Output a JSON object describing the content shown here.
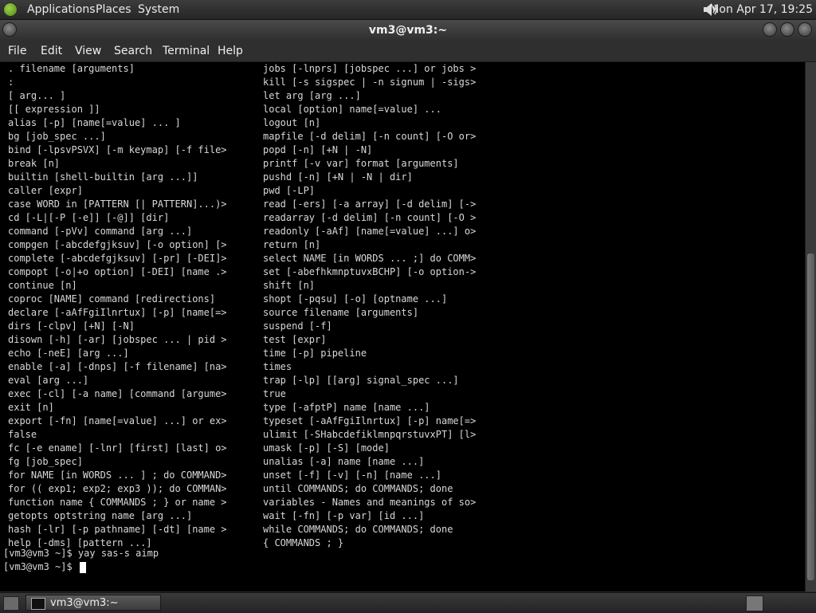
{
  "top_panel": {
    "menus": [
      "Applications",
      "Places",
      "System"
    ],
    "clock": "Mon Apr 17, 19:25"
  },
  "window": {
    "title": "vm3@vm3:~"
  },
  "menubar": [
    "File",
    "Edit",
    "View",
    "Search",
    "Terminal",
    "Help"
  ],
  "terminal": {
    "left_column": [
      ". filename [arguments]",
      ":",
      "[ arg... ]",
      "[[ expression ]]",
      "alias [-p] [name[=value] ... ]",
      "bg [job_spec ...]",
      "bind [-lpsvPSVX] [-m keymap] [-f file>",
      "break [n]",
      "builtin [shell-builtin [arg ...]]",
      "caller [expr]",
      "case WORD in [PATTERN [| PATTERN]...)>",
      "cd [-L|[-P [-e]] [-@]] [dir]",
      "command [-pVv] command [arg ...]",
      "compgen [-abcdefgjksuv] [-o option] [>",
      "complete [-abcdefgjksuv] [-pr] [-DEI]>",
      "compopt [-o|+o option] [-DEI] [name .>",
      "continue [n]",
      "coproc [NAME] command [redirections]",
      "declare [-aAfFgiIlnrtux] [-p] [name[=>",
      "dirs [-clpv] [+N] [-N]",
      "disown [-h] [-ar] [jobspec ... | pid >",
      "echo [-neE] [arg ...]",
      "enable [-a] [-dnps] [-f filename] [na>",
      "eval [arg ...]",
      "exec [-cl] [-a name] [command [argume>",
      "exit [n]",
      "export [-fn] [name[=value] ...] or ex>",
      "false",
      "fc [-e ename] [-lnr] [first] [last] o>",
      "fg [job_spec]",
      "for NAME [in WORDS ... ] ; do COMMAND>",
      "for (( exp1; exp2; exp3 )); do COMMAN>",
      "function name { COMMANDS ; } or name >",
      "getopts optstring name [arg ...]",
      "hash [-lr] [-p pathname] [-dt] [name >",
      "help [-dms] [pattern ...]"
    ],
    "right_column": [
      "jobs [-lnprs] [jobspec ...] or jobs >",
      "kill [-s sigspec | -n signum | -sigs>",
      "let arg [arg ...]",
      "local [option] name[=value] ...",
      "logout [n]",
      "mapfile [-d delim] [-n count] [-O or>",
      "popd [-n] [+N | -N]",
      "printf [-v var] format [arguments]",
      "pushd [-n] [+N | -N | dir]",
      "pwd [-LP]",
      "read [-ers] [-a array] [-d delim] [->",
      "readarray [-d delim] [-n count] [-O >",
      "readonly [-aAf] [name[=value] ...] o>",
      "return [n]",
      "select NAME [in WORDS ... ;] do COMM>",
      "set [-abefhkmnptuvxBCHP] [-o option->",
      "shift [n]",
      "shopt [-pqsu] [-o] [optname ...]",
      "source filename [arguments]",
      "suspend [-f]",
      "test [expr]",
      "time [-p] pipeline",
      "times",
      "trap [-lp] [[arg] signal_spec ...]",
      "true",
      "type [-afptP] name [name ...]",
      "typeset [-aAfFgiIlnrtux] [-p] name[=>",
      "ulimit [-SHabcdefiklmnpqrstuvxPT] [l>",
      "umask [-p] [-S] [mode]",
      "unalias [-a] name [name ...]",
      "unset [-f] [-v] [-n] [name ...]",
      "until COMMANDS; do COMMANDS; done",
      "variables - Names and meanings of so>",
      "wait [-fn] [-p var] [id ...]",
      "while COMMANDS; do COMMANDS; done",
      "{ COMMANDS ; }"
    ],
    "prompt_lines": [
      "[vm3@vm3 ~]$ yay sas-s aimp",
      "[vm3@vm3 ~]$ "
    ]
  },
  "bottom_panel": {
    "task_label": "vm3@vm3:~"
  }
}
